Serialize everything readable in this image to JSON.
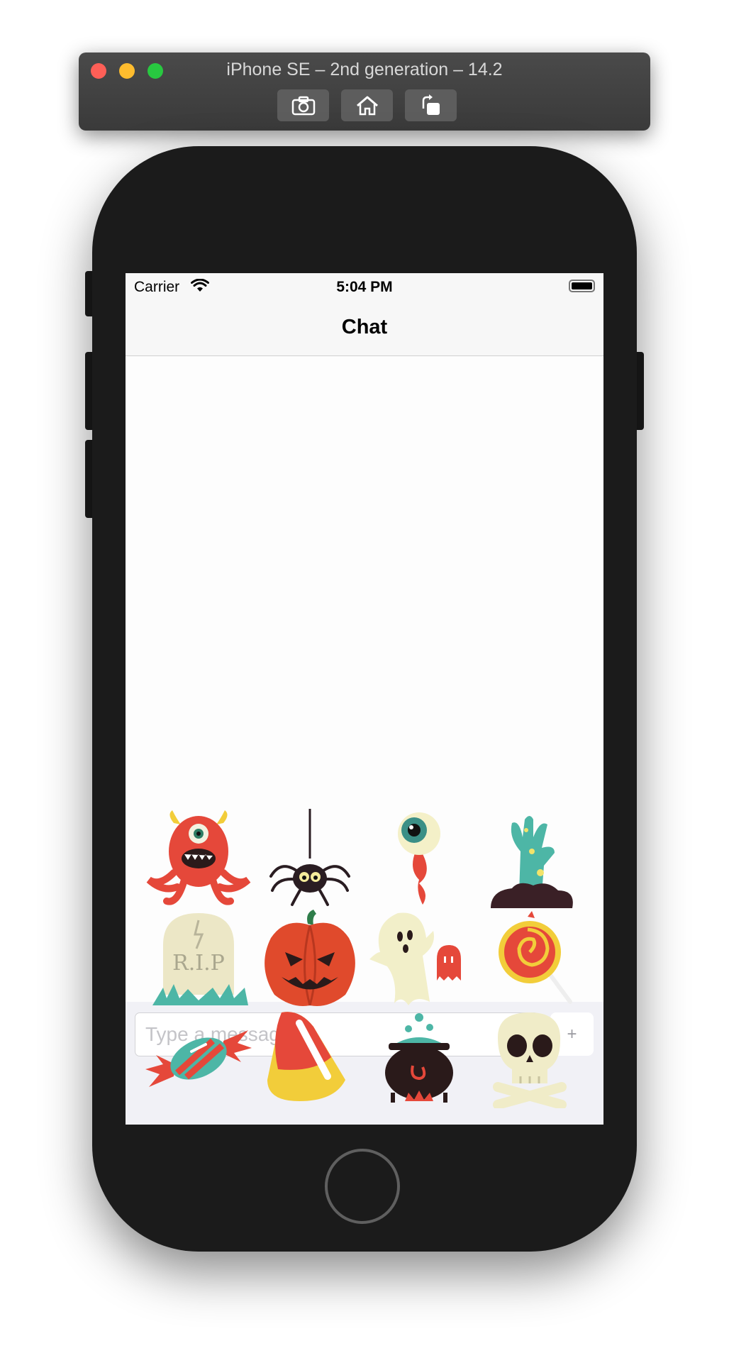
{
  "simulator": {
    "title": "iPhone SE – 2nd generation – 14.2",
    "toolbar": [
      "screenshot-icon",
      "home-icon",
      "rotate-icon"
    ]
  },
  "status_bar": {
    "carrier": "Carrier",
    "time": "5:04 PM"
  },
  "nav": {
    "title": "Chat"
  },
  "composer": {
    "placeholder": "Type a message...",
    "send_label": "+"
  },
  "stickers": [
    "monster-sticker",
    "spider-sticker",
    "eyeball-sticker",
    "zombie-hand-sticker",
    "tombstone-sticker",
    "pumpkin-sticker",
    "ghost-sticker",
    "lollipop-sticker",
    "candy-sticker",
    "candy-corn-sticker",
    "cauldron-sticker",
    "skull-sticker"
  ],
  "tombstone_text": "R.I.P"
}
